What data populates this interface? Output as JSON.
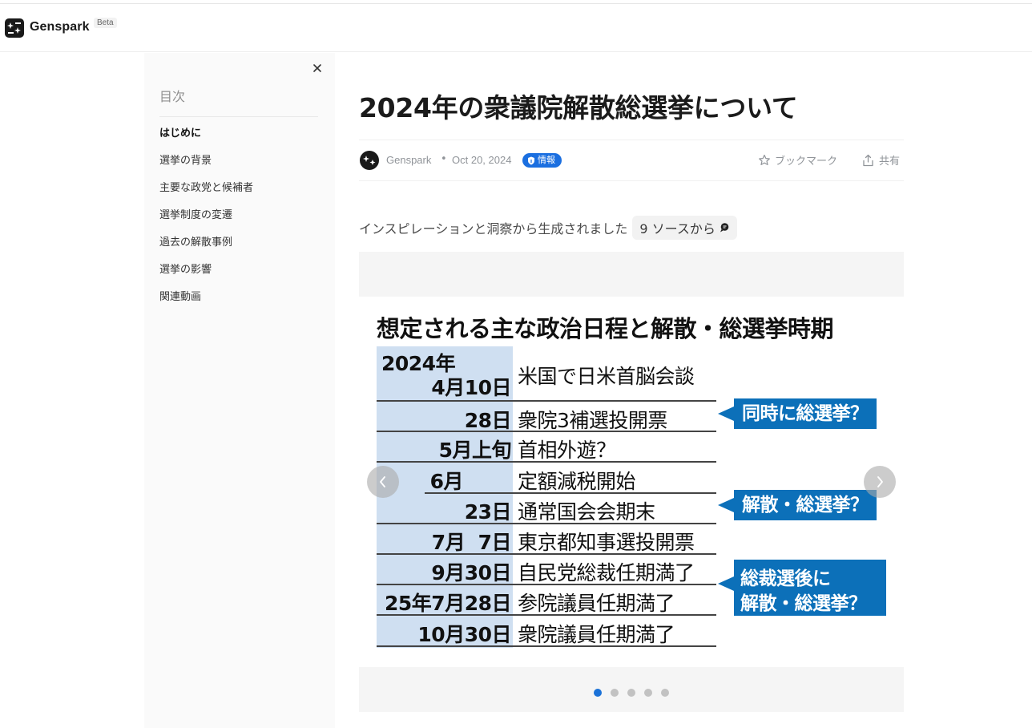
{
  "header": {
    "brand": "Genspark",
    "beta": "Beta"
  },
  "sidebar": {
    "toc_title": "目次",
    "items": [
      {
        "label": "はじめに",
        "active": true
      },
      {
        "label": "選挙の背景"
      },
      {
        "label": "主要な政党と候補者"
      },
      {
        "label": "選挙制度の変遷"
      },
      {
        "label": "過去の解散事例"
      },
      {
        "label": "選挙の影響"
      },
      {
        "label": "関連動画"
      }
    ]
  },
  "article": {
    "title": "2024年の衆議院解散総選挙について",
    "author": "Genspark",
    "separator": "•",
    "date": "Oct 20, 2024",
    "badge": "情報",
    "bookmark": "ブックマーク",
    "share": "共有",
    "intro": "インスピレーションと洞察から生成されました",
    "sources_chip": "9 ソースから"
  },
  "slide": {
    "title": "想定される主な政治日程と解散・総選挙時期",
    "rows": [
      {
        "date_line1": "2024年",
        "date_line2": "4月10日",
        "event": "米国で日米首脳会談"
      },
      {
        "date": "28日",
        "event": "衆院3補選投開票"
      },
      {
        "date": "5月上旬",
        "event": "首相外遊？"
      },
      {
        "date": "6月",
        "event": "定額減税開始"
      },
      {
        "date": "23日",
        "event": "通常国会会期末"
      },
      {
        "date": "7月  7日",
        "event": "東京都知事選投開票"
      },
      {
        "date": "9月30日",
        "event": "自民党総裁任期満了"
      },
      {
        "date": "25年7月28日",
        "event": "参院議員任期満了"
      },
      {
        "date": "10月30日",
        "event": "衆院議員任期満了"
      }
    ],
    "callouts": [
      "同時に総選挙？",
      "解散・総選挙？",
      "総裁選後に",
      "解散・総選挙？"
    ]
  },
  "carousel": {
    "slide_count": 5,
    "active_index": 0
  },
  "colors": {
    "accent": "#1b72d8",
    "callout": "#0c70b9",
    "date_column": "#cfdff1"
  }
}
